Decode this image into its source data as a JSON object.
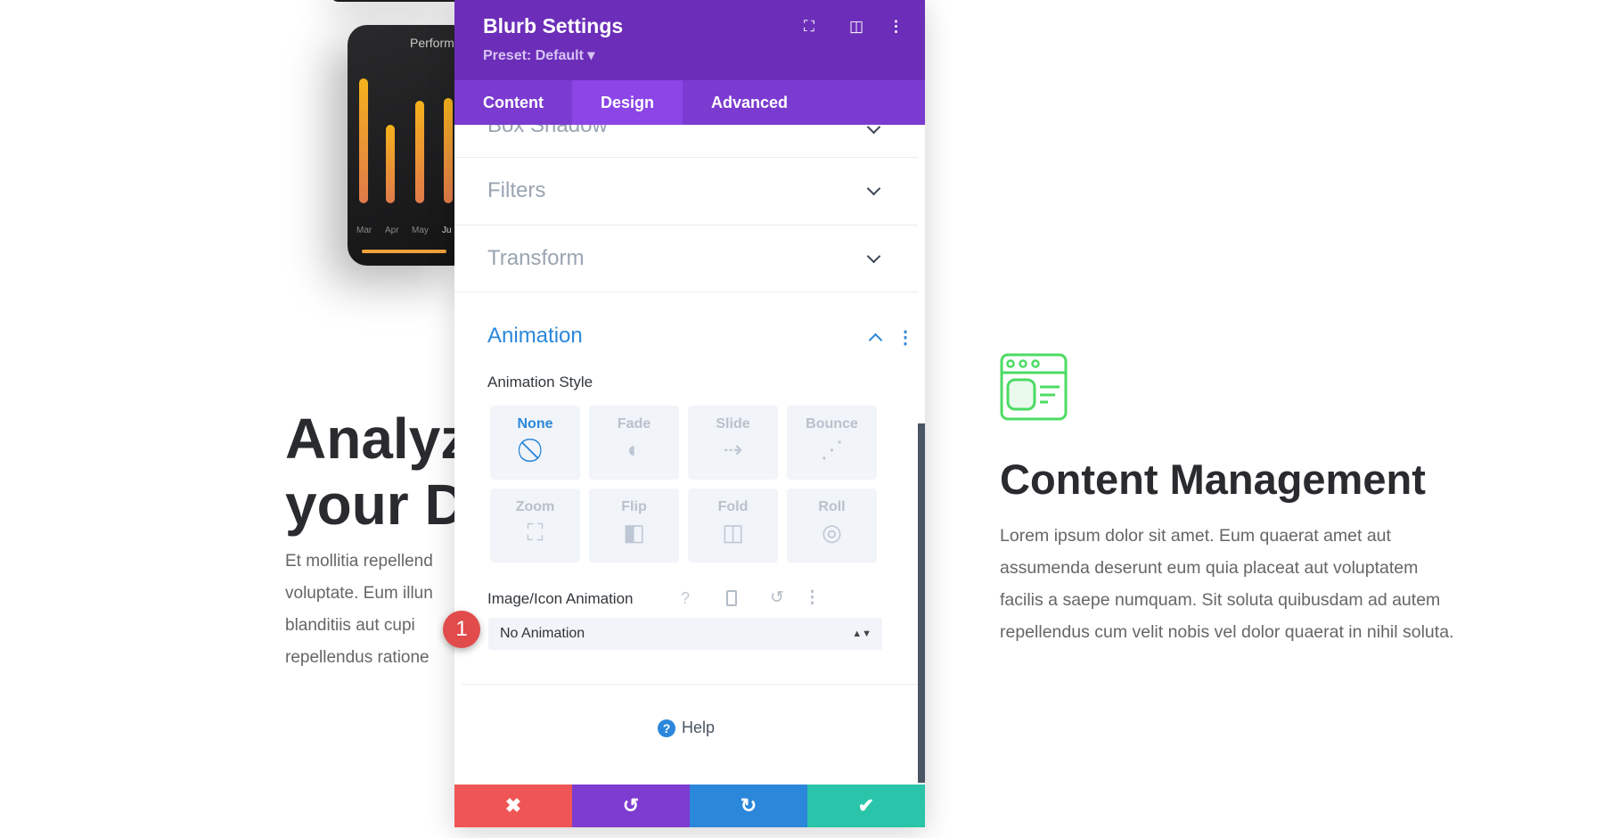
{
  "background": {
    "phone_title": "Perform",
    "months": [
      "Mar",
      "Apr",
      "May",
      "Ju"
    ],
    "bars": [
      0.85,
      0.6,
      0.72,
      0.75
    ],
    "left_heading": "Analyz\nyour D",
    "left_paragraph": [
      "Et mollitia repellend",
      "voluptate. Eum illun",
      "blanditiis aut cupi",
      "repellendus ratione"
    ],
    "right_heading": "Content Management",
    "right_paragraph": "Lorem ipsum dolor sit amet. Eum quaerat amet aut assumenda deserunt eum quia placeat aut voluptatem facilis a saepe numquam. Sit soluta quibusdam ad autem repellendus cum velit nobis vel dolor quaerat in nihil soluta.",
    "icon_color": "#4cdb63"
  },
  "panel": {
    "title": "Blurb Settings",
    "preset": "Preset: Default ▾",
    "tabs": [
      "Content",
      "Design",
      "Advanced"
    ],
    "active_tab": "Design",
    "sections": [
      "Box Shadow",
      "Filters",
      "Transform"
    ],
    "animation": {
      "title": "Animation",
      "style_label": "Animation Style",
      "styles": [
        {
          "n": "None",
          "i": "⃠"
        },
        {
          "n": "Fade",
          "i": "◐"
        },
        {
          "n": "Slide",
          "i": "⇢"
        },
        {
          "n": "Bounce",
          "i": "⋰"
        },
        {
          "n": "Zoom",
          "i": "⛶"
        },
        {
          "n": "Flip",
          "i": "◧"
        },
        {
          "n": "Fold",
          "i": "◫"
        },
        {
          "n": "Roll",
          "i": "◎"
        }
      ],
      "selected_style": "None",
      "image_anim_label": "Image/Icon Animation",
      "image_anim_value": "No Animation"
    },
    "help": "Help",
    "colors": {
      "header": "#6c2eb9",
      "cancel": "#ef5555",
      "undo": "#7e3bd0",
      "redo": "#2b87da",
      "save": "#29c4a9"
    }
  },
  "badge": "1"
}
